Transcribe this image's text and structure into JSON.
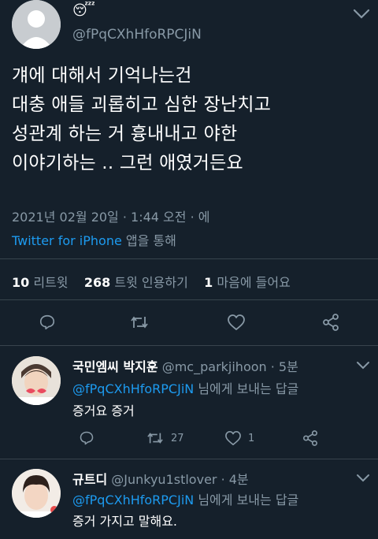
{
  "accent": "#1d9bf0",
  "background": "#15202b",
  "author": {
    "handle": "@fPqCXhHfoRPCJiN",
    "emoji": "😴"
  },
  "tweet": {
    "lines": [
      "걔에 대해서 기억나는건",
      "대충 애들 괴롭히고 심한 장난치고",
      "성관계 하는 거 흉내내고 야한",
      "이야기하는 .. 그런 애였거든요"
    ],
    "timestamp": "2021년 02월 20일 · 1:44 오전 · 에",
    "source_app": "Twitter for iPhone",
    "source_suffix": "앱을 통해"
  },
  "stats": {
    "retweets_count": "10",
    "retweets_label": "리트윗",
    "quotes_count": "268",
    "quotes_label": "트윗 인용하기",
    "likes_count": "1",
    "likes_label": "마음에 들어요"
  },
  "actions": [
    "reply-icon",
    "retweet-icon",
    "like-icon",
    "share-icon"
  ],
  "replies": [
    {
      "name": "국민엠씨 박지훈",
      "handle": "@mc_parkjihoon",
      "time": "· 5분",
      "mention": "@fPqCXhHfoRPCJiN",
      "mention_suffix": "님에게 보내는 답글",
      "text": "증거요 증거",
      "retweets": "27",
      "likes": "1"
    },
    {
      "name": "규트디",
      "handle": "@Junkyu1stlover",
      "time": "· 4분",
      "mention": "@fPqCXhHfoRPCJiN",
      "mention_suffix": "님에게 보내는 답글",
      "text": "증거 가지고 말해요."
    }
  ]
}
